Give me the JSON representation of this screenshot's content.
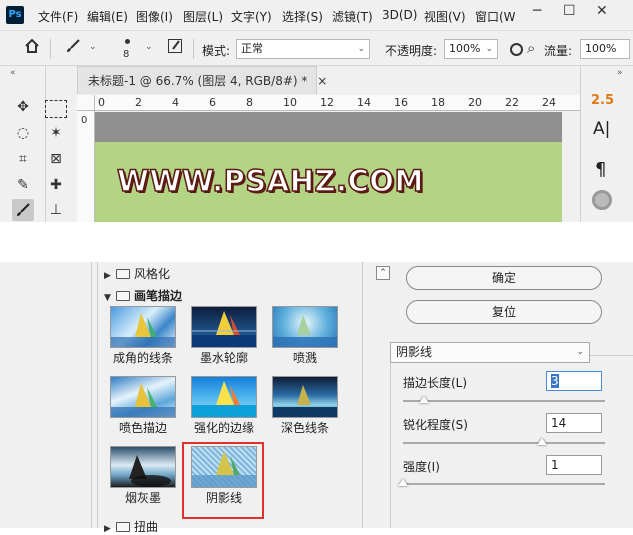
{
  "app": {
    "logo": "Ps"
  },
  "menubar": {
    "items": [
      "文件(F)",
      "编辑(E)",
      "图像(I)",
      "图层(L)",
      "文字(Y)",
      "选择(S)",
      "滤镜(T)",
      "3D(D)",
      "视图(V)",
      "窗口(W"
    ],
    "window_controls": [
      "─",
      "☐",
      "✕"
    ]
  },
  "options": {
    "brush_size": "8",
    "mode_label": "模式:",
    "mode_value": "正常",
    "opacity_label": "不透明度:",
    "opacity_value": "100%",
    "flow_label": "流量:",
    "flow_value": "100%"
  },
  "document": {
    "tab_title": "未标题-1 @ 66.7% (图层 4, RGB/8#) *",
    "tab_close": "×",
    "ruler_ticks": [
      "0",
      "2",
      "4",
      "6",
      "8",
      "10",
      "12",
      "14",
      "16",
      "18",
      "20",
      "22",
      "24"
    ],
    "ruler_v_tick": "0",
    "canvas_text": "WWW.PSAHZ.COM"
  },
  "right_panel": {
    "char_size": "2.5",
    "type_glyph": "A|",
    "para_glyph": "¶"
  },
  "filter_gallery": {
    "categories": [
      {
        "label": "风格化",
        "expanded": false
      },
      {
        "label": "画笔描边",
        "expanded": true
      },
      {
        "label": "扭曲",
        "expanded": false
      }
    ],
    "filters": [
      {
        "label": "成角的线条"
      },
      {
        "label": "墨水轮廓"
      },
      {
        "label": "喷溅"
      },
      {
        "label": "喷色描边"
      },
      {
        "label": "强化的边缘"
      },
      {
        "label": "深色线条"
      },
      {
        "label": "烟灰墨"
      },
      {
        "label": "阴影线",
        "selected": true
      }
    ],
    "ok_label": "确定",
    "reset_label": "复位",
    "filter_select": "阴影线",
    "params": [
      {
        "label": "描边长度(L)",
        "value": "3",
        "max": 50
      },
      {
        "label": "锐化程度(S)",
        "value": "14",
        "max": 20
      },
      {
        "label": "强度(I)",
        "value": "1",
        "max": 3
      }
    ],
    "colors": {
      "highlight": "#e03030",
      "canvas_green": "#b4d485"
    }
  }
}
